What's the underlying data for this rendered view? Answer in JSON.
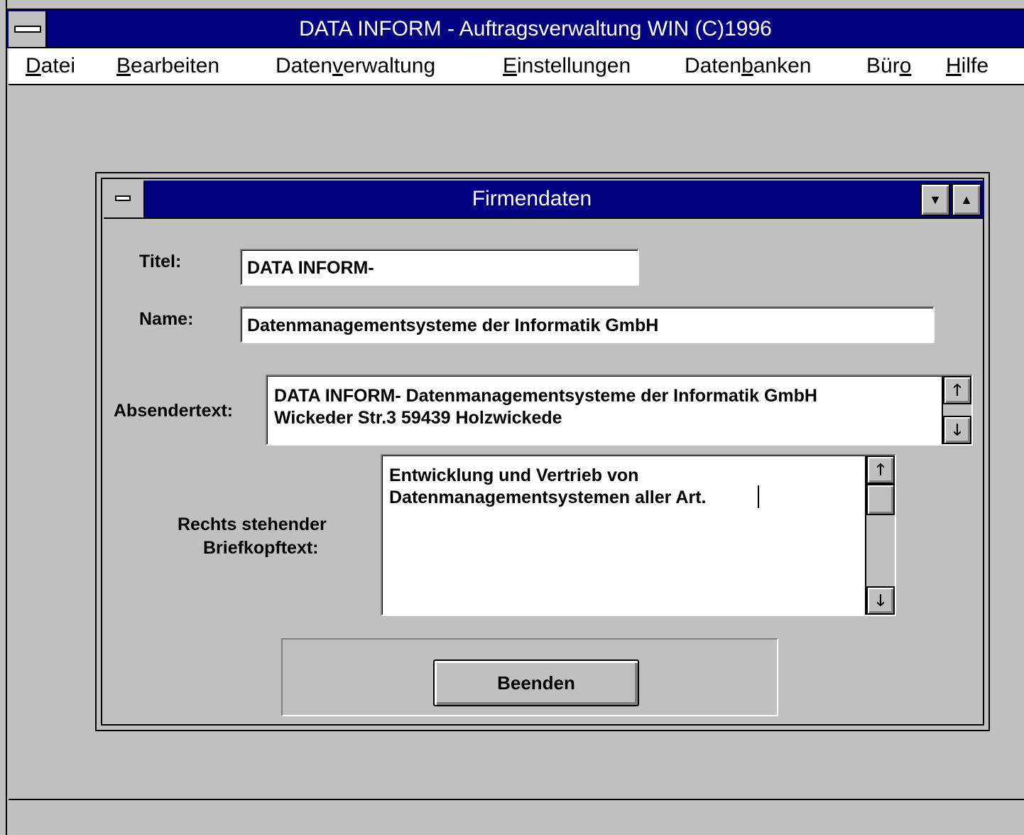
{
  "app": {
    "title": "DATA INFORM - Auftragsverwaltung WIN (C)1996"
  },
  "menu": [
    {
      "prefix": "",
      "accel": "D",
      "suffix": "atei"
    },
    {
      "prefix": "",
      "accel": "B",
      "suffix": "earbeiten"
    },
    {
      "prefix": "Daten",
      "accel": "v",
      "suffix": "erwaltung"
    },
    {
      "prefix": "",
      "accel": "E",
      "suffix": "instellungen"
    },
    {
      "prefix": "Daten",
      "accel": "b",
      "suffix": "anken"
    },
    {
      "prefix": "Bür",
      "accel": "o",
      "suffix": ""
    },
    {
      "prefix": "",
      "accel": "H",
      "suffix": "ilfe"
    }
  ],
  "dialog": {
    "title": "Firmendaten",
    "minimize_glyph": "▼",
    "maximize_glyph": "▲",
    "fields": {
      "titel_label": "Titel:",
      "titel_value": "DATA INFORM-",
      "name_label": "Name:",
      "name_value": "Datenmanagementsysteme der Informatik GmbH",
      "absender_label": "Absendertext:",
      "absender_lines": [
        "DATA INFORM- Datenmanagementsysteme der Informatik GmbH",
        "Wickeder Str.3 59439 Holzwickede"
      ],
      "briefkopf_label_line1": "Rechts stehender",
      "briefkopf_label_line2": "Briefkopftext:",
      "briefkopf_lines": [
        "Entwicklung und Vertrieb von",
        "Datenmanagementsystemen aller Art."
      ]
    },
    "scroll_up_glyph": "🡑",
    "scroll_down_glyph": "🡓",
    "beenden_label": "Beenden"
  }
}
